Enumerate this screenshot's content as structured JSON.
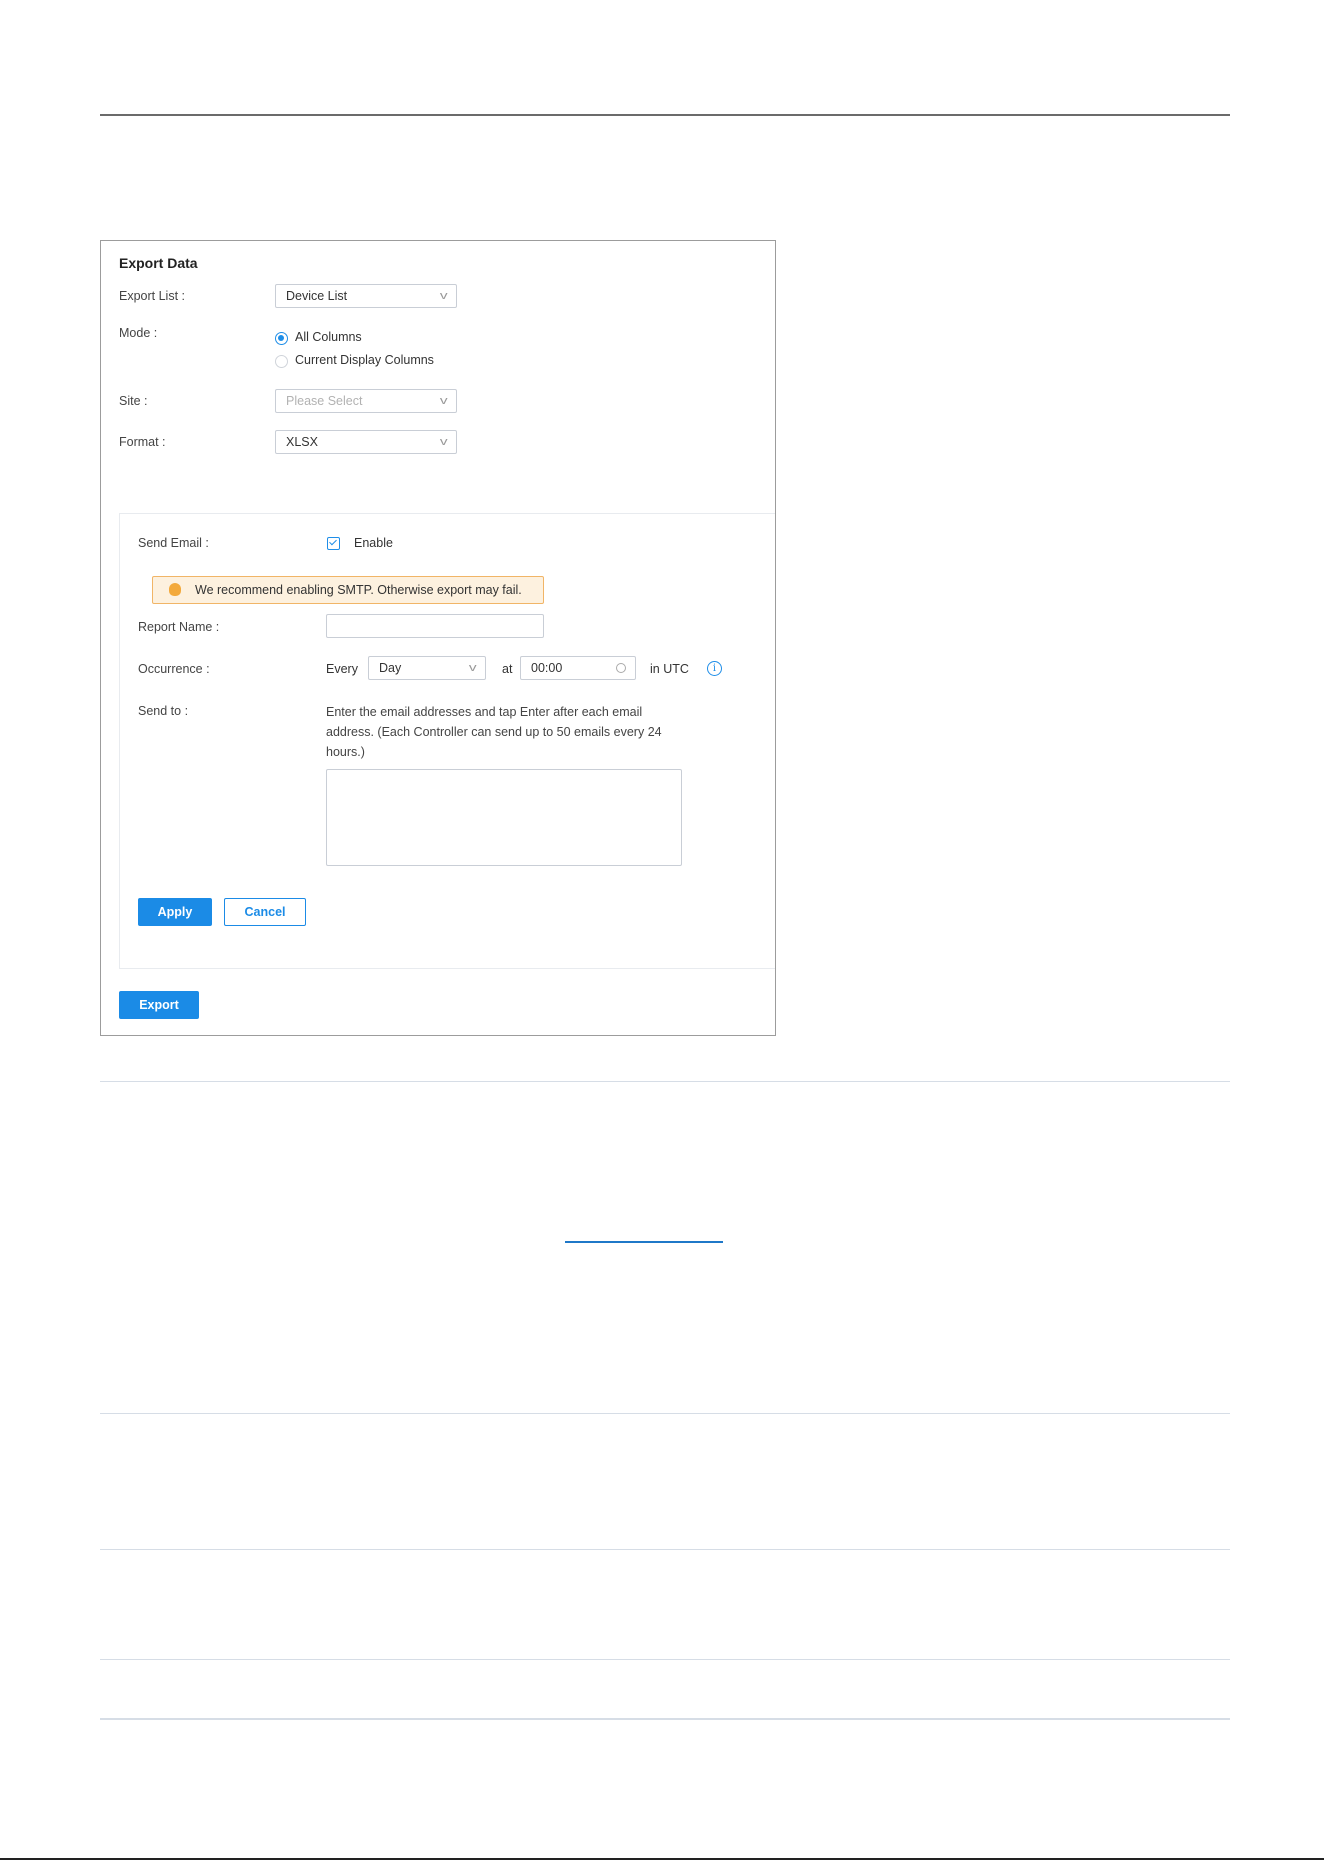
{
  "export_panel": {
    "title": "Export Data",
    "export_list": {
      "label": "Export List :",
      "value": "Device List"
    },
    "mode": {
      "label": "Mode :",
      "options": [
        {
          "label": "All Columns",
          "selected": true
        },
        {
          "label": "Current Display Columns",
          "selected": false
        }
      ]
    },
    "site": {
      "label": "Site :",
      "placeholder": "Please Select"
    },
    "format": {
      "label": "Format :",
      "value": "XLSX"
    },
    "send_email": {
      "label": "Send Email :",
      "enable_label": "Enable",
      "enabled": true,
      "warning": "We recommend enabling SMTP. Otherwise export may fail.",
      "report_name": {
        "label": "Report Name :",
        "value": ""
      },
      "occurrence": {
        "label": "Occurrence :",
        "every_label": "Every",
        "frequency": "Day",
        "at_label": "at",
        "time": "00:00",
        "timezone_label": "in UTC"
      },
      "send_to": {
        "label": "Send to :",
        "help": "Enter the email addresses and tap Enter after each email address. (Each Controller can send up to 50 emails every 24 hours.)",
        "value": ""
      },
      "apply_label": "Apply",
      "cancel_label": "Cancel"
    },
    "export_label": "Export"
  },
  "colors": {
    "primary": "#1b8be6",
    "warning_bg": "#fdf1df",
    "warning_border": "#f1b567",
    "bulb": "#f3a93b"
  }
}
